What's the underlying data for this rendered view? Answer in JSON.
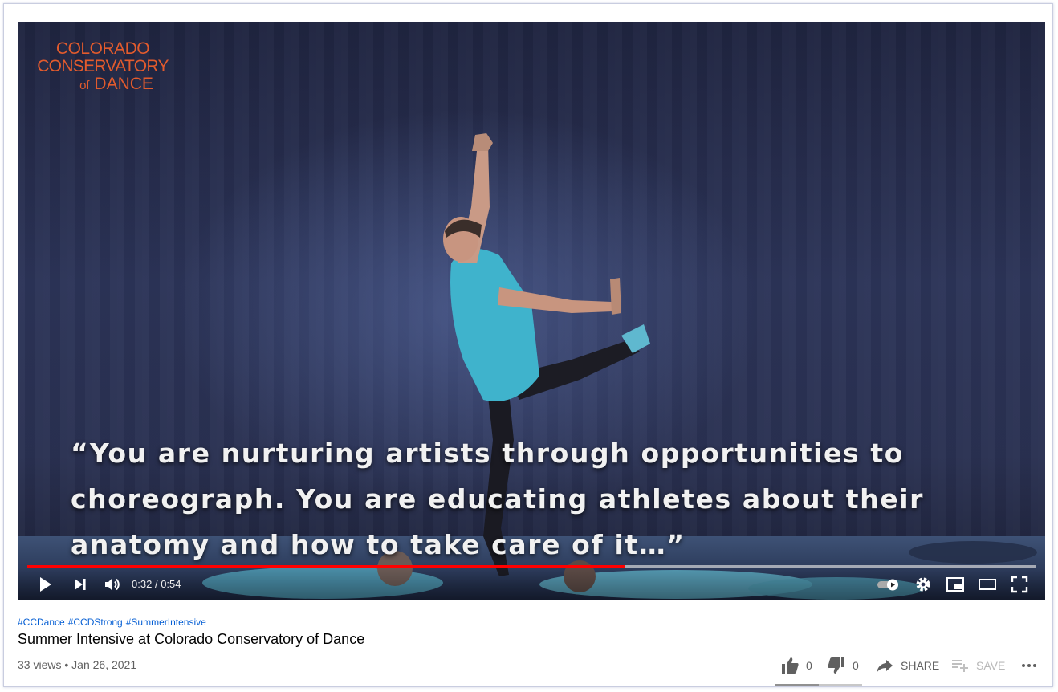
{
  "player": {
    "logo": {
      "line1": "COLORADO",
      "line2": "CONSERVATORY",
      "line3_of": "of",
      "line3": "DANCE"
    },
    "caption": "“You are nurturing artists through opportunities to choreograph. You are educating athletes about their anatomy and how to take care of it…”",
    "time_current": "0:32",
    "time_separator": "/",
    "time_total": "0:54",
    "progress_fraction": 0.5926,
    "buffered_fraction": 1.0,
    "accent_color": "#ff0000",
    "controls": {
      "play_icon": "play-icon",
      "next_icon": "next-icon",
      "volume_icon": "volume-icon",
      "autoplay_icon": "autoplay-toggle-icon",
      "settings_icon": "gear-icon",
      "miniplayer_icon": "miniplayer-icon",
      "theater_icon": "theater-mode-icon",
      "fullscreen_icon": "fullscreen-icon"
    }
  },
  "video_info": {
    "hashtags": [
      "#CCDance",
      "#CCDStrong",
      "#SummerIntensive"
    ],
    "title": "Summer Intensive at Colorado Conservatory of Dance",
    "views": "33 views",
    "separator": "•",
    "date": "Jan 26, 2021"
  },
  "actions": {
    "like_count": "0",
    "dislike_count": "0",
    "share_label": "SHARE",
    "save_label": "SAVE",
    "more_icon": "more-options-icon",
    "like_fraction": 0.5
  }
}
